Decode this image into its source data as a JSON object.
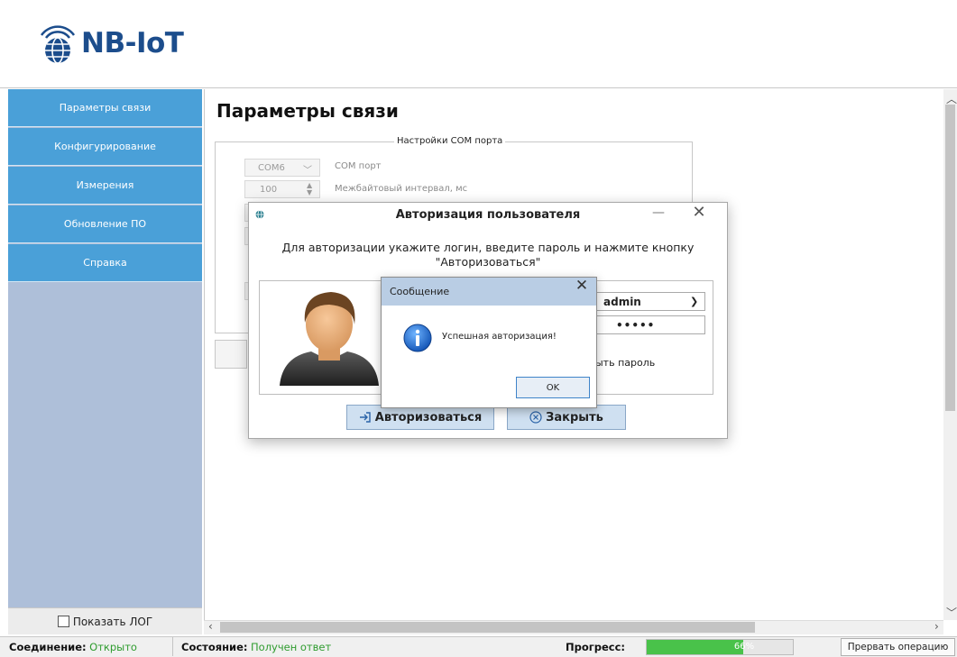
{
  "app": {
    "logo_text": "NB-IoT"
  },
  "sidebar": {
    "items": [
      {
        "label": "Параметры связи"
      },
      {
        "label": "Конфигурирование"
      },
      {
        "label": "Измерения"
      },
      {
        "label": "Обновление ПО"
      },
      {
        "label": "Справка"
      }
    ],
    "show_log_label": "Показать ЛОГ"
  },
  "main": {
    "title": "Параметры связи",
    "com_group_title": "Настройки COM порта",
    "com_port_value": "COM6",
    "com_port_label": "COM порт",
    "interval_value": "100",
    "interval_label": "Межбайтовый интервал, мс"
  },
  "auth_dialog": {
    "title": "Авторизация пользователя",
    "instruction_line1": "Для авторизации укажите логин, введите пароль и нажмите кнопку",
    "instruction_line2": "\"Авторизоваться\"",
    "login_value": "admin",
    "password_value": "•••••",
    "show_password_label": "ыть пароль",
    "authorize_label": "Авторизоваться",
    "close_label": "Закрыть"
  },
  "message_box": {
    "title": "Сообщение",
    "text": "Успешная авторизация!",
    "ok_label": "OK"
  },
  "statusbar": {
    "connection_label": "Соединение:",
    "connection_value": "Открыто",
    "state_label": "Состояние:",
    "state_value": "Получен ответ",
    "progress_label": "Прогресс:",
    "progress_text": "66%",
    "progress_fraction": 0.66,
    "abort_label": "Прервать операцию"
  },
  "colors": {
    "nav": "#4aa0d8",
    "sidebar_bg": "#aebfd9",
    "logo": "#1c4d8c",
    "status_ok": "#2f9c2f",
    "progress": "#49c24a"
  }
}
